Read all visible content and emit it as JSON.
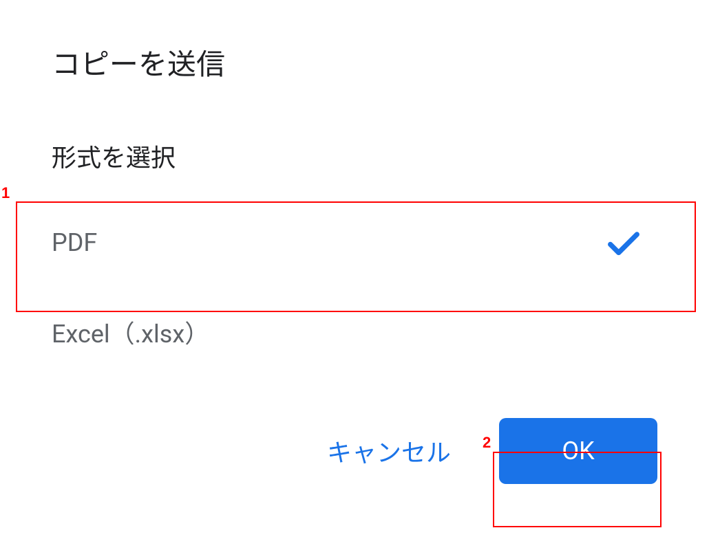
{
  "dialog": {
    "title": "コピーを送信",
    "section_label": "形式を選択",
    "options": [
      {
        "label": "PDF",
        "selected": true
      },
      {
        "label": "Excel（.xlsx）",
        "selected": false
      }
    ],
    "actions": {
      "cancel": "キャンセル",
      "ok": "OK"
    }
  },
  "annotations": [
    {
      "id": "1"
    },
    {
      "id": "2"
    }
  ],
  "colors": {
    "accent": "#1a73e8",
    "text_primary": "#202124",
    "text_secondary": "#5f6368",
    "annotation": "#ff0000"
  }
}
